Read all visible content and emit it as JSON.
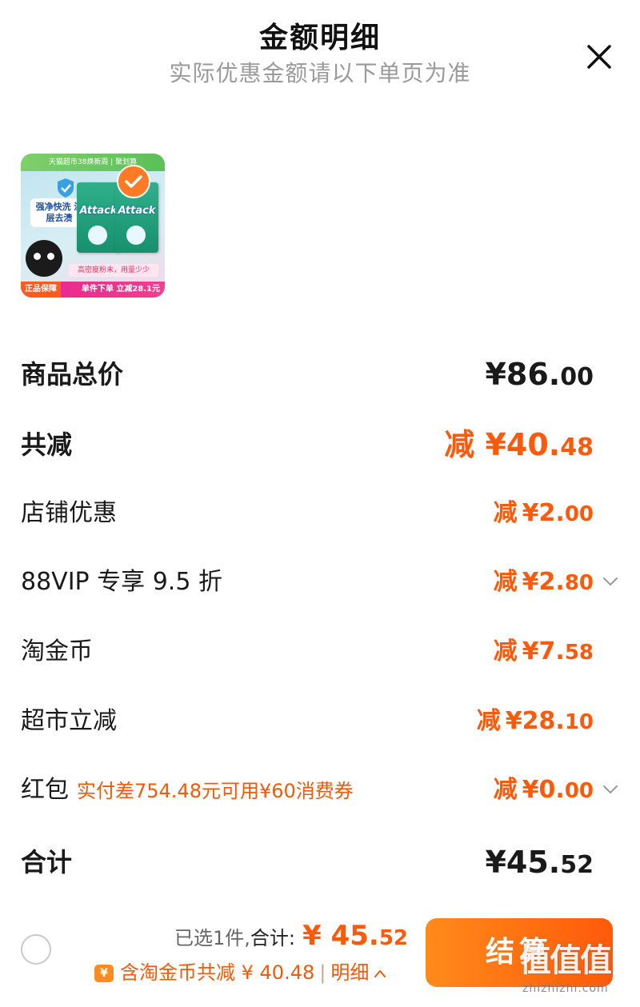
{
  "header": {
    "title": "金额明细",
    "subtitle": "实际优惠金额请以下单页为准"
  },
  "product": {
    "banner": "天猫超市38焕新周 | 聚划算",
    "slogan": "强净快洗 深层去渍",
    "brand": "Attack",
    "sublabel": "高密度粉末，用量少少",
    "guarantee": "正品保障",
    "promo": "单件下单 立减28.1元",
    "selected": true
  },
  "rows": [
    {
      "label": "商品总价",
      "amount_main": "¥86.",
      "amount_cents": "00"
    },
    {
      "label": "共减",
      "prefix": "减",
      "amount_main": "¥40.",
      "amount_cents": "48"
    },
    {
      "label": "店铺优惠",
      "prefix": "减",
      "amount_main": "¥2.",
      "amount_cents": "00"
    },
    {
      "label": "88VIP 专享 9.5 折",
      "prefix": "减",
      "amount_main": "¥2.",
      "amount_cents": "80"
    },
    {
      "label": "淘金币",
      "prefix": "减",
      "amount_main": "¥7.",
      "amount_cents": "58"
    },
    {
      "label": "超市立减",
      "prefix": "减",
      "amount_main": "¥28.",
      "amount_cents": "10"
    },
    {
      "label": "红包",
      "note": "实付差754.48元可用¥60消费券",
      "prefix": "减",
      "amount_main": "¥0.",
      "amount_cents": "00"
    },
    {
      "label": "合计",
      "amount_main": "¥45.",
      "amount_cents": "52"
    }
  ],
  "footer": {
    "selected_text": "已选1件,",
    "total_label": "合计:",
    "total_main": "¥ 45.",
    "total_cents": "52",
    "coin_icon": "¥",
    "coin_text": "含淘金币共减 ¥ 40.48",
    "separator": "|",
    "detail_label": "明细",
    "checkout_label": "结算"
  },
  "watermark": {
    "logo": "值值值",
    "url": "zhizhizhi.com"
  },
  "colors": {
    "accent": "#ff5a0a",
    "note": "#f05a0a",
    "subtitle": "#9a9a9a",
    "text": "#1a1a1a"
  },
  "icons": {
    "close": "close-icon",
    "check": "check-icon",
    "expand": "chevron-down-icon",
    "collapse": "chevron-up-icon",
    "coin": "coin-icon"
  }
}
